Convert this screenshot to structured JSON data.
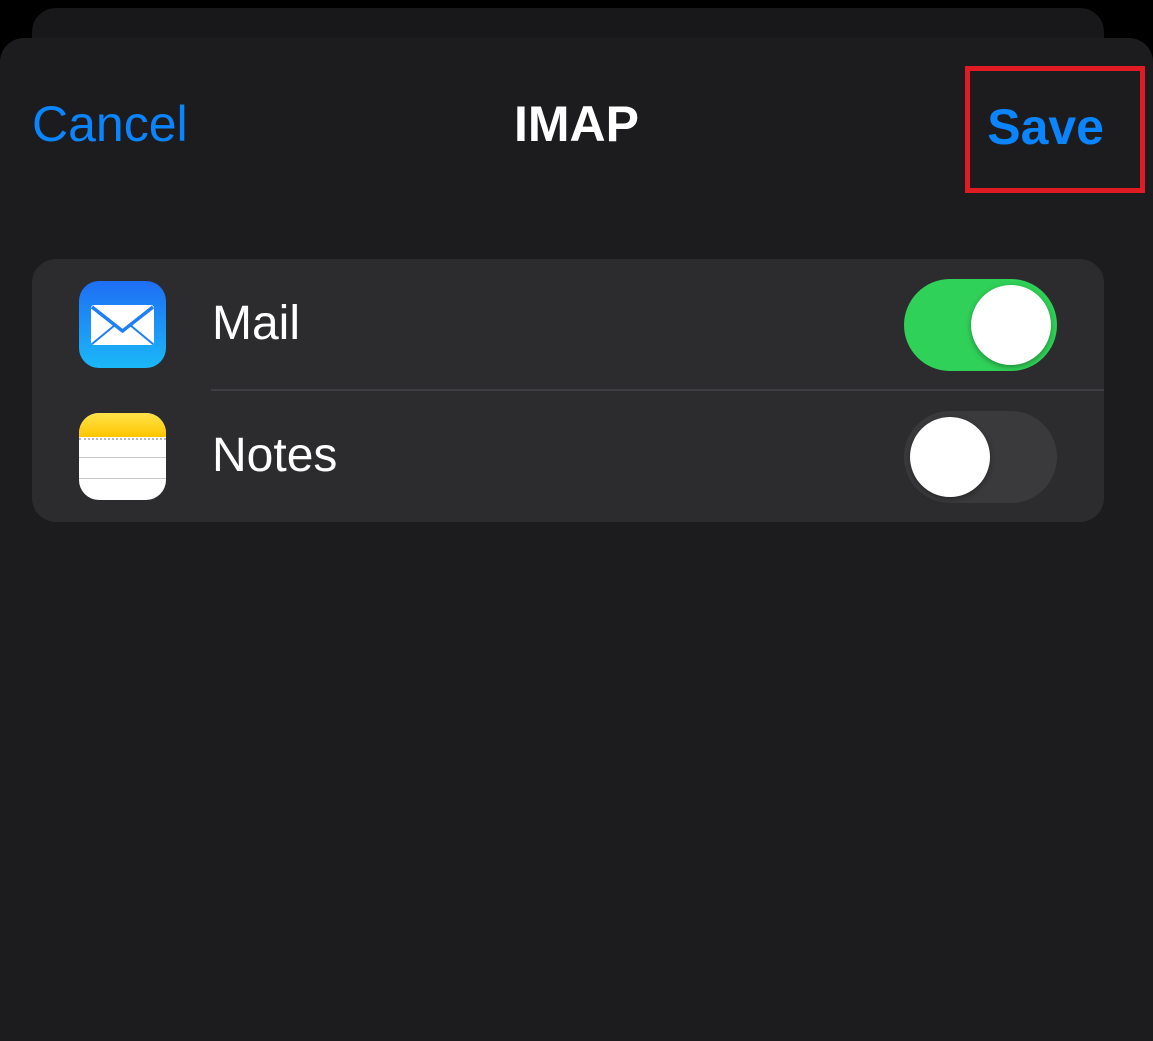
{
  "nav": {
    "cancel_label": "Cancel",
    "title": "IMAP",
    "save_label": "Save"
  },
  "apps": [
    {
      "label": "Mail",
      "icon": "mail-icon",
      "enabled": true
    },
    {
      "label": "Notes",
      "icon": "notes-icon",
      "enabled": false
    }
  ],
  "colors": {
    "accent": "#0a84ff",
    "toggle_on": "#30d158",
    "highlight_box": "#e01b24",
    "background": "#1c1c1e",
    "group_background": "#2c2c2e"
  }
}
